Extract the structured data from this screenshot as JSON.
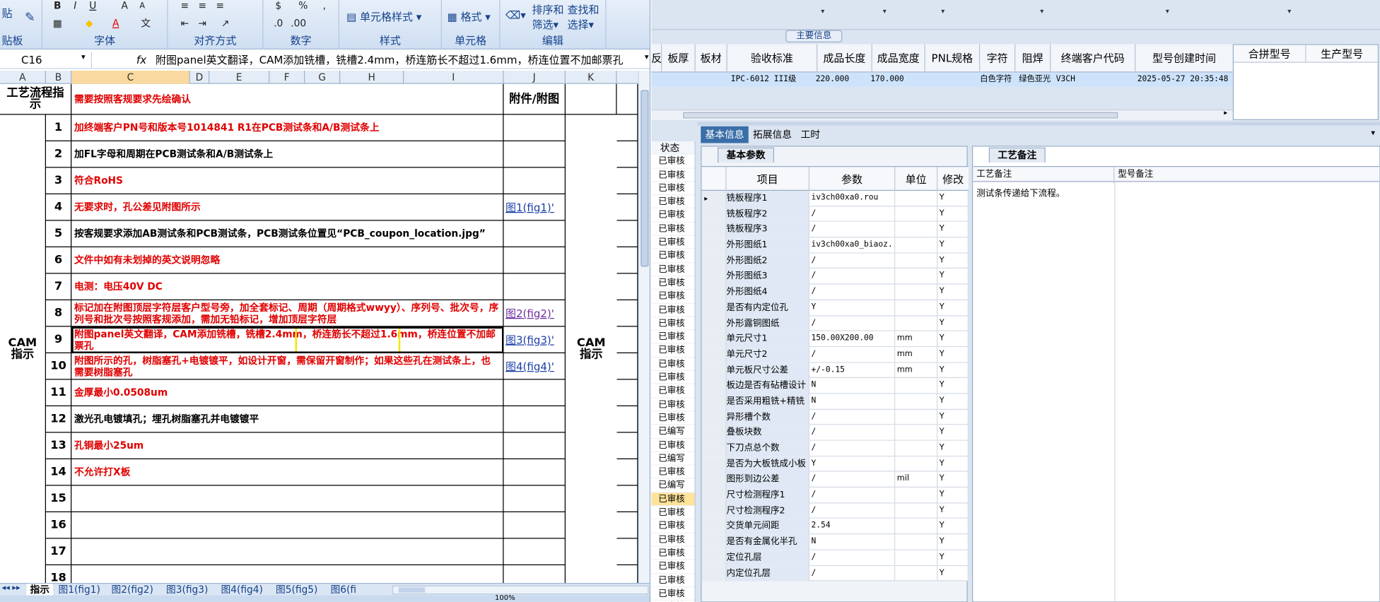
{
  "excel": {
    "ribbon": {
      "groups": [
        {
          "label": "贴板"
        },
        {
          "label": "字体"
        },
        {
          "label": "对齐方式"
        },
        {
          "label": "数字"
        },
        {
          "label": "样式"
        },
        {
          "label": "单元格"
        },
        {
          "label": "编辑"
        }
      ],
      "paste_label": "贴",
      "style_cell_label": "单元格样式",
      "format_label": "格式",
      "sort_label_1": "排序和",
      "sort_label_2": "筛选",
      "find_label_1": "查找和",
      "find_label_2": "选择"
    },
    "namebox": "C16",
    "formula": "附图panel英文翻译，CAM添加铣槽，铣槽2.4mm，桥连筋长不超过1.6mm，桥连位置不加邮票孔",
    "columns": [
      "A",
      "B",
      "C",
      "D",
      "E",
      "F",
      "G",
      "H",
      "I",
      "J",
      "K"
    ],
    "header_left": "工艺流程指示",
    "header_main": "需要按照客规要求先绘确认",
    "header_attach": "附件/附图",
    "side_left": "CAM指示",
    "side_right": "CAM指示",
    "rows": [
      {
        "num": "1",
        "text": "加终端客户PN号和版本号1014841 R1在PCB测试条和A/B测试条上",
        "red": true,
        "attach": ""
      },
      {
        "num": "2",
        "text": "加FL字母和周期在PCB测试条和A/B测试条上",
        "red": false,
        "attach": ""
      },
      {
        "num": "3",
        "text": "符合RoHS",
        "red": true,
        "attach": ""
      },
      {
        "num": "4",
        "text": "无要求时，孔公差见附图所示",
        "red": true,
        "attach": "图1(fig1)'"
      },
      {
        "num": "5",
        "text": "按客规要求添加AB测试条和PCB测试条，PCB测试条位置见“PCB_coupon_location.jpg”",
        "red": false,
        "attach": ""
      },
      {
        "num": "6",
        "text": "文件中如有未划掉的英文说明忽略",
        "red": true,
        "attach": ""
      },
      {
        "num": "7",
        "text": "电测：电压40V DC",
        "red": true,
        "attach": ""
      },
      {
        "num": "8",
        "text": "标记加在附图顶层字符层客户型号旁，加全套标记、周期（周期格式wwyy）、序列号、批次号，序列号和批次号按照客规添加，需加无铅标记，增加顶层字符层",
        "red": true,
        "attach": "图2(fig2)'"
      },
      {
        "num": "9",
        "text": "附图panel英文翻译，CAM添加铣槽，铣槽2.4mm，桥连筋长不超过1.6mm，桥连位置不加邮票孔",
        "red": true,
        "attach": "图3(fig3)'"
      },
      {
        "num": "10",
        "text": "附图所示的孔，树脂塞孔+电镀镀平，如设计开窗，需保留开窗制作；如果这些孔在测试条上，也需要树脂塞孔",
        "red": true,
        "attach": "图4(fig4)'"
      },
      {
        "num": "11",
        "text": "金厚最小0.0508um",
        "red": true,
        "attach": ""
      },
      {
        "num": "12",
        "text": "激光孔电镀填孔；埋孔树脂塞孔并电镀镀平",
        "red": false,
        "attach": ""
      },
      {
        "num": "13",
        "text": "孔铜最小25um",
        "red": true,
        "attach": ""
      },
      {
        "num": "14",
        "text": "不允许打X板",
        "red": true,
        "attach": ""
      },
      {
        "num": "15",
        "text": "",
        "red": false,
        "attach": ""
      },
      {
        "num": "16",
        "text": "",
        "red": false,
        "attach": ""
      },
      {
        "num": "17",
        "text": "",
        "red": false,
        "attach": ""
      },
      {
        "num": "18",
        "text": "",
        "red": false,
        "attach": ""
      }
    ],
    "sheet_tabs": [
      "指示",
      "图1(fig1)",
      "图2(fig2)",
      "图3(fig3)",
      "图4(fig4)",
      "图5(fig5)",
      "图6(fi"
    ],
    "zoom": "100%"
  },
  "app": {
    "main_info_label": "主要信息",
    "headers": [
      "反",
      "板厚",
      "板材",
      "验收标准",
      "成品长度",
      "成品宽度",
      "PNL规格",
      "字符",
      "阻焊",
      "终端客户代码",
      "型号创建时间"
    ],
    "right_headers": [
      "合拼型号",
      "生产型号"
    ],
    "selected_row": {
      "standard": "IPC-6012 III级",
      "length": "220.000",
      "width": "170.000",
      "char": "白色字符",
      "mask": "绿色亚光",
      "code": "V3CH",
      "created": "2025-05-27 20:35:48"
    },
    "tabs": [
      "基本信息",
      "拓展信息",
      "工时"
    ],
    "status_header": "状态",
    "statuses": [
      "已审核",
      "已审核",
      "已审核",
      "已审核",
      "已审核",
      "已审核",
      "已审核",
      "已审核",
      "已审核",
      "已审核",
      "已审核",
      "已审核",
      "已审核",
      "已审核",
      "已审核",
      "已审核",
      "已审核",
      "已审核",
      "已审核",
      "已审核",
      "已编写",
      "已审核",
      "已编写",
      "已审核",
      "已编写",
      "已审核",
      "已审核",
      "已审核",
      "已审核",
      "已审核",
      "已审核",
      "已审核",
      "已审核",
      "已审核"
    ],
    "status_highlight_index": 25,
    "params_tab": "基本参数",
    "params_headers": [
      "项目",
      "参数",
      "单位",
      "修改"
    ],
    "params": [
      {
        "item": "铣板程序1",
        "val": "iv3ch00xa0.rou",
        "unit": "",
        "mod": "Y"
      },
      {
        "item": "铣板程序2",
        "val": "/",
        "unit": "",
        "mod": "Y"
      },
      {
        "item": "铣板程序3",
        "val": "/",
        "unit": "",
        "mod": "Y"
      },
      {
        "item": "外形图纸1",
        "val": "iv3ch00xa0_biaoz...",
        "unit": "",
        "mod": "Y"
      },
      {
        "item": "外形图纸2",
        "val": "/",
        "unit": "",
        "mod": "Y"
      },
      {
        "item": "外形图纸3",
        "val": "/",
        "unit": "",
        "mod": "Y"
      },
      {
        "item": "外形图纸4",
        "val": "/",
        "unit": "",
        "mod": "Y"
      },
      {
        "item": "是否有内定位孔",
        "val": "Y",
        "unit": "",
        "mod": "Y"
      },
      {
        "item": "外形露铜图纸",
        "val": "/",
        "unit": "",
        "mod": "Y"
      },
      {
        "item": "单元尺寸1",
        "val": "150.00X200.00",
        "unit": "mm",
        "mod": "Y"
      },
      {
        "item": "单元尺寸2",
        "val": "/",
        "unit": "mm",
        "mod": "Y"
      },
      {
        "item": "单元板尺寸公差",
        "val": "+/-0.15",
        "unit": "mm",
        "mod": "Y"
      },
      {
        "item": "板边是否有砧槽设计",
        "val": "N",
        "unit": "",
        "mod": "Y"
      },
      {
        "item": "是否采用粗铣+精铣",
        "val": "N",
        "unit": "",
        "mod": "Y"
      },
      {
        "item": "异形槽个数",
        "val": "/",
        "unit": "",
        "mod": "Y"
      },
      {
        "item": "叠板块数",
        "val": "/",
        "unit": "",
        "mod": "Y"
      },
      {
        "item": "下刀点总个数",
        "val": "/",
        "unit": "",
        "mod": "Y"
      },
      {
        "item": "是否为大板铣成小板",
        "val": "Y",
        "unit": "",
        "mod": "Y"
      },
      {
        "item": "图形到边公差",
        "val": "/",
        "unit": "mil",
        "mod": "Y"
      },
      {
        "item": "尺寸检测程序1",
        "val": "/",
        "unit": "",
        "mod": "Y"
      },
      {
        "item": "尺寸检测程序2",
        "val": "/",
        "unit": "",
        "mod": "Y"
      },
      {
        "item": "交货单元间距",
        "val": "2.54",
        "unit": "",
        "mod": "Y"
      },
      {
        "item": "是否有金属化半孔",
        "val": "N",
        "unit": "",
        "mod": "Y"
      },
      {
        "item": "定位孔层",
        "val": "/",
        "unit": "",
        "mod": "Y"
      },
      {
        "item": "内定位孔层",
        "val": "/",
        "unit": "",
        "mod": "Y"
      }
    ],
    "notes_tab": "工艺备注",
    "notes_headers": [
      "工艺备注",
      "型号备注"
    ],
    "notes_text": "测试条传递给下流程。"
  }
}
